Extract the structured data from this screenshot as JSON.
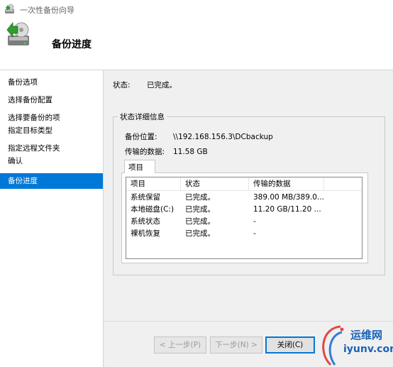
{
  "window": {
    "title": "一次性备份向导"
  },
  "header": {
    "heading": "备份进度"
  },
  "sidebar": {
    "items": [
      {
        "label": "备份选项"
      },
      {
        "label": "选择备份配置"
      },
      {
        "label": "选择要备份的项"
      },
      {
        "label": "指定目标类型"
      },
      {
        "label": "指定远程文件夹"
      },
      {
        "label": "确认"
      },
      {
        "label": "备份进度"
      }
    ],
    "active_index": 6,
    "active_color": "#0078d7"
  },
  "status": {
    "label": "状态:",
    "value": "已完成。"
  },
  "details": {
    "group_title": "状态详细信息",
    "location_label": "备份位置:",
    "location_value": "\\\\192.168.156.3\\DCbackup",
    "transferred_label": "传输的数据:",
    "transferred_value": "11.58 GB",
    "tab_label": "项目",
    "columns": [
      "项目",
      "状态",
      "传输的数据"
    ],
    "rows": [
      [
        "系统保留",
        "已完成。",
        "389.00 MB/389.0..."
      ],
      [
        "本地磁盘(C:)",
        "已完成。",
        "11.20 GB/11.20 ..."
      ],
      [
        "系统状态",
        "已完成。",
        "-"
      ],
      [
        "裸机恢复",
        "已完成。",
        "-"
      ]
    ]
  },
  "footer": {
    "prev_label": "< 上一步(P)",
    "next_label": "下一步(N) >",
    "close_label": "关闭(C)"
  },
  "watermark": {
    "line1": "运维网",
    "line2": "iyunv.com",
    "color": "#1a62b7"
  },
  "icons": {
    "app": "backup-drive-icon",
    "header": "backup-drive-large-icon"
  }
}
